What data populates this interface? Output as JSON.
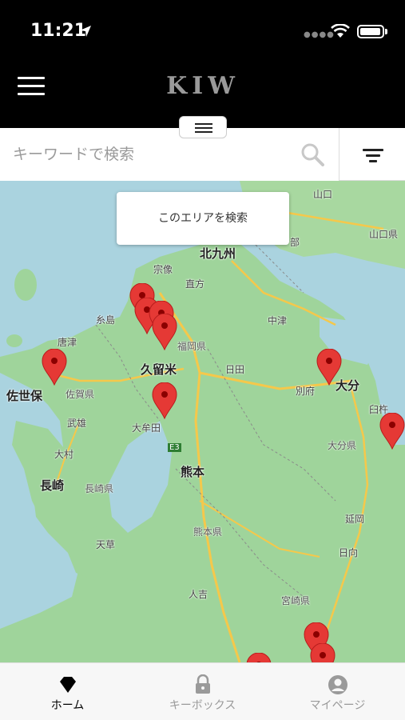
{
  "status_bar": {
    "time": "11:21"
  },
  "header": {
    "logo_text": "KIW"
  },
  "search": {
    "placeholder": "キーワードで検索",
    "value": ""
  },
  "map": {
    "search_area_label": "このエリアを検索",
    "labels": {
      "yamaguchi": "山口",
      "yamaguchi_pref": "山口県",
      "kitakyushu": "北九州",
      "munakata": "宗像",
      "nogata": "直方",
      "itoshima": "糸島",
      "fukuoka_pref": "福岡県",
      "nakatsu": "中津",
      "karatsu": "唐津",
      "kurume": "久留米",
      "hita": "日田",
      "beppu": "別府",
      "oita": "大分",
      "sasebo": "佐世保",
      "saga_pref": "佐賀県",
      "takeo": "武雄",
      "omuta": "大牟田",
      "usuki": "臼杵",
      "oita_pref": "大分県",
      "omura": "大村",
      "kumamoto": "熊本",
      "nagasaki": "長崎",
      "nagasaki_pref": "長崎県",
      "nobeoka": "延岡",
      "amakusa": "天草",
      "kumamoto_pref": "熊本県",
      "hyuga": "日向",
      "hitoyoshi": "人吉",
      "miyazaki_pref": "宮崎県",
      "be": "部",
      "e3": "E3"
    }
  },
  "tabs": [
    {
      "label": "ホーム",
      "active": true
    },
    {
      "label": "キーボックス",
      "active": false
    },
    {
      "label": "マイページ",
      "active": false
    }
  ],
  "colors": {
    "accent": "#000000",
    "inactive": "#9a9a9a",
    "pin": "#e53935",
    "land": "#9fd49b",
    "water": "#aad3df"
  },
  "icons": {
    "home": "diamond-icon",
    "keybox": "lock-icon",
    "mypage": "person-icon",
    "search": "search-icon",
    "filter": "filter-icon",
    "menu": "hamburger-icon",
    "pin": "map-pin-icon"
  }
}
